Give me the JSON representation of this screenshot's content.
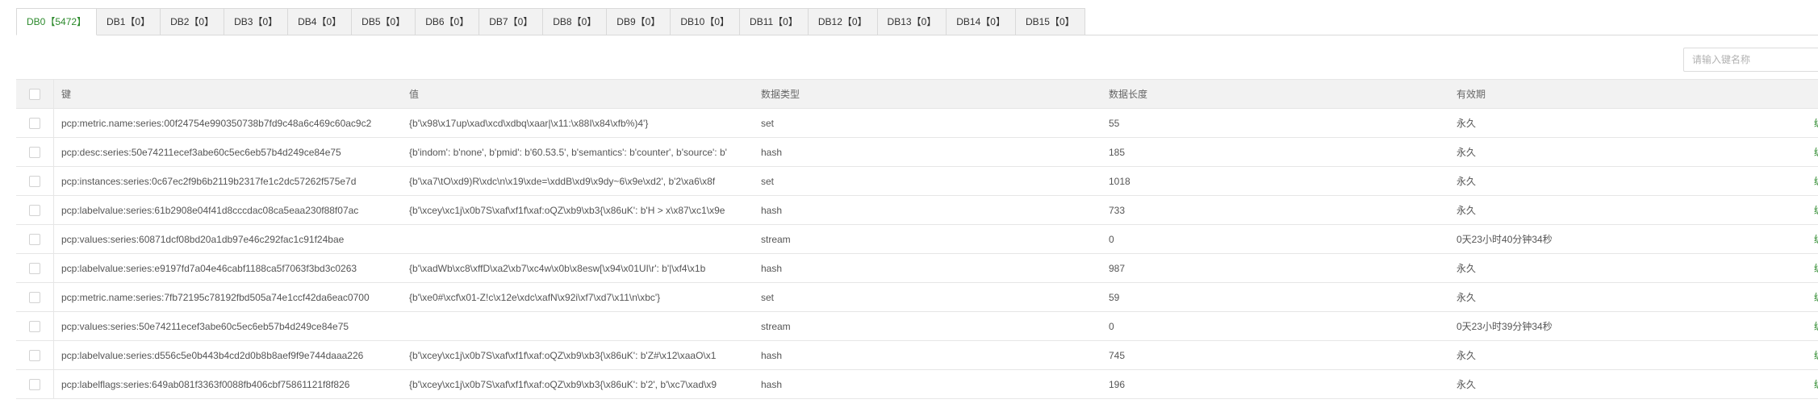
{
  "tabs": [
    {
      "label": "DB0【5472】",
      "active": true
    },
    {
      "label": "DB1【0】",
      "active": false
    },
    {
      "label": "DB2【0】",
      "active": false
    },
    {
      "label": "DB3【0】",
      "active": false
    },
    {
      "label": "DB4【0】",
      "active": false
    },
    {
      "label": "DB5【0】",
      "active": false
    },
    {
      "label": "DB6【0】",
      "active": false
    },
    {
      "label": "DB7【0】",
      "active": false
    },
    {
      "label": "DB8【0】",
      "active": false
    },
    {
      "label": "DB9【0】",
      "active": false
    },
    {
      "label": "DB10【0】",
      "active": false
    },
    {
      "label": "DB11【0】",
      "active": false
    },
    {
      "label": "DB12【0】",
      "active": false
    },
    {
      "label": "DB13【0】",
      "active": false
    },
    {
      "label": "DB14【0】",
      "active": false
    },
    {
      "label": "DB15【0】",
      "active": false
    }
  ],
  "search": {
    "placeholder": "请输入键名称",
    "value": ""
  },
  "table": {
    "columns": {
      "key": "键",
      "value": "值",
      "type": "数据类型",
      "length": "数据长度",
      "ttl": "有效期"
    },
    "rows": [
      {
        "key": "pcp:metric.name:series:00f24754e990350738b7fd9c48a6c469c60ac9c2",
        "value": "{b'\\x98\\x17up\\xad\\xcd\\xdbq\\xaar|\\x11:\\x88I\\x84\\xfb%)4'}",
        "type": "set",
        "length": "55",
        "ttl": "永久",
        "op": "编"
      },
      {
        "key": "pcp:desc:series:50e74211ecef3abe60c5ec6eb57b4d249ce84e75",
        "value": "{b'indom': b'none', b'pmid': b'60.53.5', b'semantics': b'counter', b'source': b'",
        "type": "hash",
        "length": "185",
        "ttl": "永久",
        "op": "编"
      },
      {
        "key": "pcp:instances:series:0c67ec2f9b6b2119b2317fe1c2dc57262f575e7d",
        "value": "{b'\\xa7\\tO\\xd9)R\\xdc\\n\\x19\\xde=\\xddB\\xd9\\x9dy~6\\x9e\\xd2', b'2\\xa6\\x8f",
        "type": "set",
        "length": "1018",
        "ttl": "永久",
        "op": "编"
      },
      {
        "key": "pcp:labelvalue:series:61b2908e04f41d8cccdac08ca5eaa230f88f07ac",
        "value": "{b'\\xcey\\xc1j\\x0b7S\\xaf\\xf1f\\xaf:oQZ\\xb9\\xb3{\\x86uK': b'H > x\\x87\\xc1\\x9e",
        "type": "hash",
        "length": "733",
        "ttl": "永久",
        "op": "编"
      },
      {
        "key": "pcp:values:series:60871dcf08bd20a1db97e46c292fac1c91f24bae",
        "value": "",
        "type": "stream",
        "length": "0",
        "ttl": "0天23小时40分钟34秒",
        "op": "编"
      },
      {
        "key": "pcp:labelvalue:series:e9197fd7a04e46cabf1188ca5f7063f3bd3c0263",
        "value": "{b'\\xadWb\\xc8\\xffD\\xa2\\xb7\\xc4w\\x0b\\x8esw[\\x94\\x01UI\\r': b'|\\xf4\\x1b",
        "type": "hash",
        "length": "987",
        "ttl": "永久",
        "op": "编"
      },
      {
        "key": "pcp:metric.name:series:7fb72195c78192fbd505a74e1ccf42da6eac0700",
        "value": "{b'\\xe0#\\xcf\\x01-Z!c\\x12e\\xdc\\xafN\\x92i\\xf7\\xd7\\x11\\n\\xbc'}",
        "type": "set",
        "length": "59",
        "ttl": "永久",
        "op": "编"
      },
      {
        "key": "pcp:values:series:50e74211ecef3abe60c5ec6eb57b4d249ce84e75",
        "value": "",
        "type": "stream",
        "length": "0",
        "ttl": "0天23小时39分钟34秒",
        "op": "编"
      },
      {
        "key": "pcp:labelvalue:series:d556c5e0b443b4cd2d0b8b8aef9f9e744daaa226",
        "value": "{b'\\xcey\\xc1j\\x0b7S\\xaf\\xf1f\\xaf:oQZ\\xb9\\xb3{\\x86uK': b'Z#\\x12\\xaaO\\x1",
        "type": "hash",
        "length": "745",
        "ttl": "永久",
        "op": "编"
      },
      {
        "key": "pcp:labelflags:series:649ab081f3363f0088fb406cbf75861121f8f826",
        "value": "{b'\\xcey\\xc1j\\x0b7S\\xaf\\xf1f\\xaf:oQZ\\xb9\\xb3{\\x86uK': b'2', b'\\xc7\\xad\\x9",
        "type": "hash",
        "length": "196",
        "ttl": "永久",
        "op": "编"
      }
    ]
  },
  "colors": {
    "accent": "#2d8a2d",
    "tab_inactive_bg": "#f2f2f2",
    "header_bg": "#f2f2f2",
    "border": "#e6e6e6"
  }
}
